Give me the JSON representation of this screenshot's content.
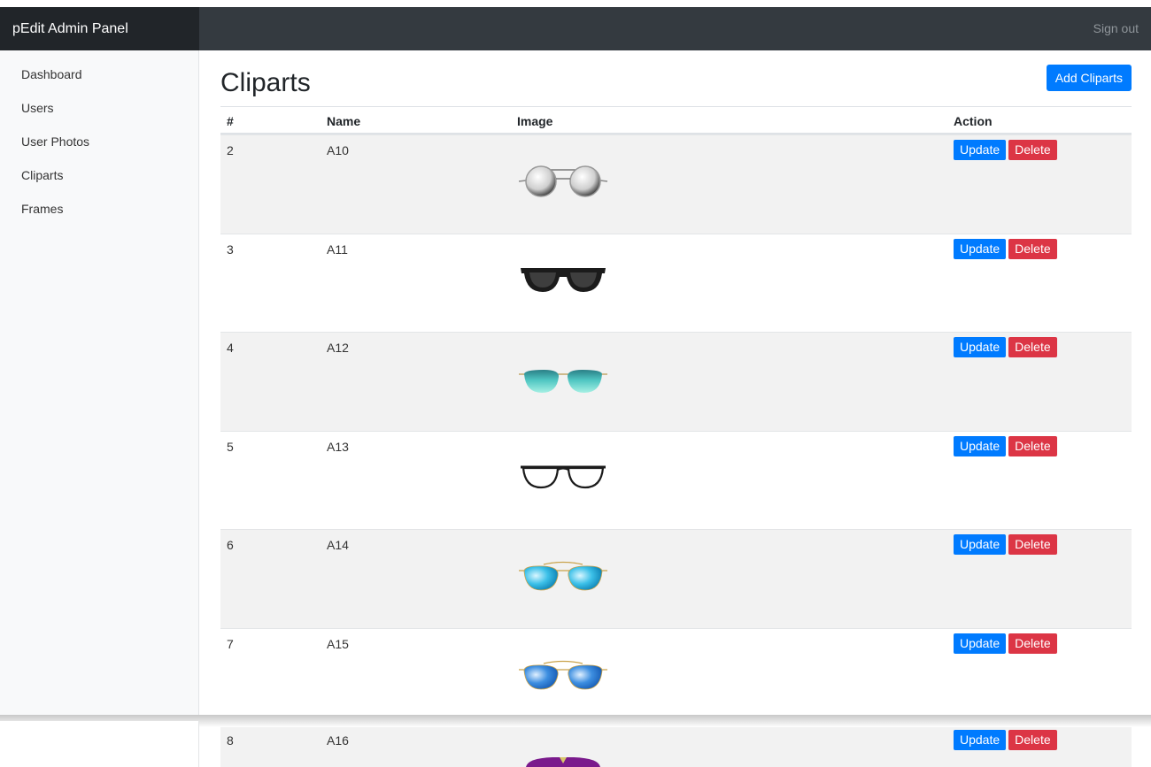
{
  "header": {
    "brand": "pEdit Admin Panel",
    "signout_label": "Sign out"
  },
  "sidebar": {
    "items": [
      {
        "label": "Dashboard"
      },
      {
        "label": "Users"
      },
      {
        "label": "User Photos"
      },
      {
        "label": "Cliparts"
      },
      {
        "label": "Frames"
      }
    ]
  },
  "main": {
    "title": "Cliparts",
    "add_label": "Add Cliparts",
    "columns": [
      "#",
      "Name",
      "Image",
      "Action"
    ],
    "update_label": "Update",
    "delete_label": "Delete",
    "rows": [
      {
        "id": "2",
        "name": "A10",
        "image": "round-mirror-sunglasses"
      },
      {
        "id": "3",
        "name": "A11",
        "image": "black-wayfarer-sunglasses"
      },
      {
        "id": "4",
        "name": "A12",
        "image": "teal-aviator-sunglasses"
      },
      {
        "id": "5",
        "name": "A13",
        "image": "clear-rectangle-glasses"
      },
      {
        "id": "6",
        "name": "A14",
        "image": "blue-aviator-sunglasses"
      },
      {
        "id": "7",
        "name": "A15",
        "image": "blue-aviator-sunglasses"
      },
      {
        "id": "8",
        "name": "A16",
        "image": "purple-sunglasses"
      }
    ]
  },
  "colors": {
    "primary": "#007bff",
    "danger": "#dc3545",
    "navbar": "#343a40",
    "brand_bg": "#212529",
    "stripe": "#f2f2f2"
  }
}
